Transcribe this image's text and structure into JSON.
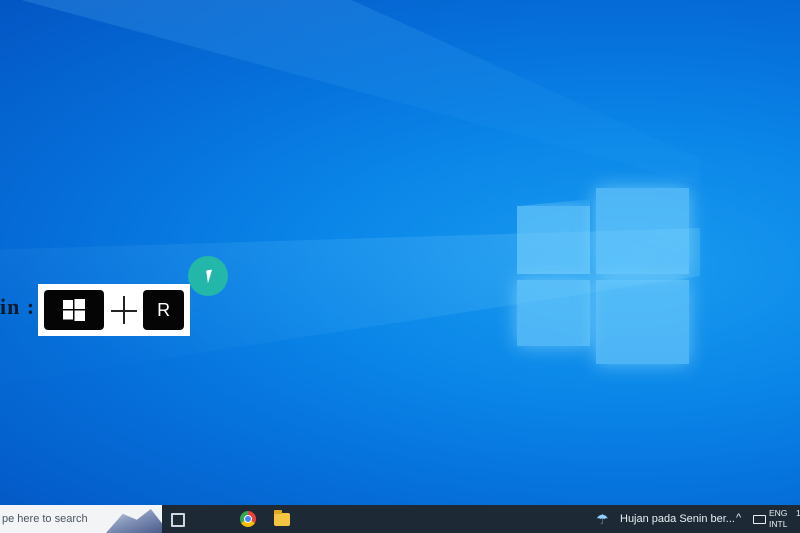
{
  "overlay": {
    "caption": "in :",
    "shortcut_key": "R"
  },
  "taskbar": {
    "search_placeholder": "pe here to search",
    "weather_text": "Hujan pada Senin ber...",
    "lang_line1": "ENG",
    "lang_line2": "INTL",
    "clock_line1": "",
    "clock_line2": "1"
  },
  "icons": [
    "windows-logo-icon",
    "plus-icon",
    "task-view-icon",
    "copilot-icon",
    "chrome-icon",
    "file-explorer-icon",
    "weather-icon",
    "chevron-up-icon",
    "battery-icon"
  ]
}
